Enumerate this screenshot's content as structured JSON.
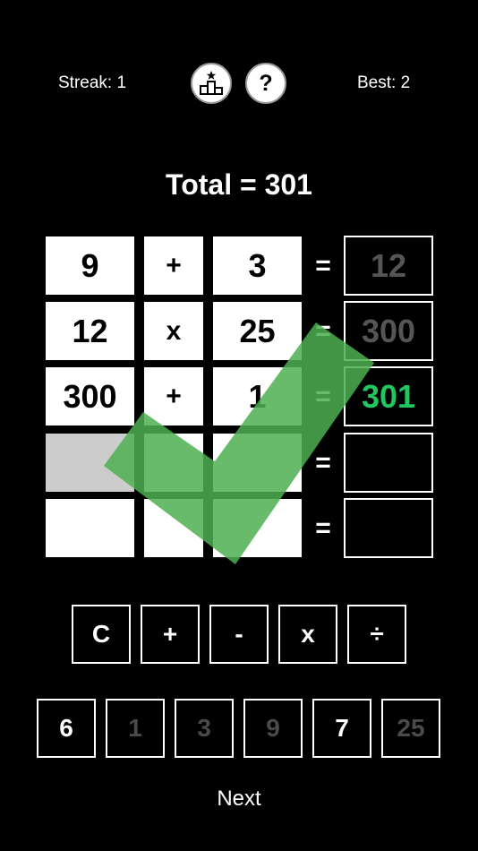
{
  "header": {
    "streak": "Streak: 1",
    "best": "Best: 2",
    "leaderboard_icon": "podium-star-icon",
    "help_label": "?"
  },
  "total_label": "Total = 301",
  "equals": "=",
  "rows": [
    {
      "a": "9",
      "op": "+",
      "b": "3",
      "result": "12",
      "state": "done"
    },
    {
      "a": "12",
      "op": "x",
      "b": "25",
      "result": "300",
      "state": "done"
    },
    {
      "a": "300",
      "op": "+",
      "b": "1",
      "result": "301",
      "state": "target"
    },
    {
      "a": "",
      "op": "",
      "b": "",
      "result": "",
      "state": "empty"
    },
    {
      "a": "",
      "op": "",
      "b": "",
      "result": "",
      "state": "empty"
    }
  ],
  "operators": [
    "C",
    "+",
    "-",
    "x",
    "÷"
  ],
  "numbers": [
    {
      "value": "6",
      "used": false
    },
    {
      "value": "1",
      "used": true
    },
    {
      "value": "3",
      "used": true
    },
    {
      "value": "9",
      "used": true
    },
    {
      "value": "7",
      "used": false
    },
    {
      "value": "25",
      "used": true
    }
  ],
  "next_label": "Next",
  "colors": {
    "background": "#000000",
    "success": "#22c55e",
    "checkmark": "#4caf50",
    "selected_cell": "#cccccc",
    "dimmed_text": "#555555"
  },
  "overlay": {
    "icon": "checkmark-icon"
  }
}
